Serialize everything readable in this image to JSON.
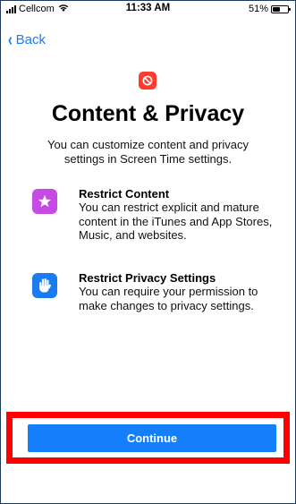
{
  "status_bar": {
    "carrier": "Cellcom",
    "time": "11:33 AM",
    "battery_percent": "51%",
    "battery_level": 0.51
  },
  "nav": {
    "back_label": "Back"
  },
  "header": {
    "icon": "screen-time-restrictions-icon",
    "icon_color": "#ff3b30",
    "title": "Content & Privacy",
    "subtitle": "You can customize content and privacy settings in Screen Time settings."
  },
  "features": [
    {
      "icon": "star-icon",
      "icon_color": "#c64be4",
      "title": "Restrict Content",
      "body": "You can restrict explicit and mature content in the iTunes and App Stores, Music, and websites."
    },
    {
      "icon": "hand-icon",
      "icon_color": "#1a7cf0",
      "title": "Restrict Privacy Settings",
      "body": "You can require your permission to make changes to privacy settings."
    }
  ],
  "footer": {
    "continue_label": "Continue",
    "accent": "#147efb",
    "highlight_color": "#ff0000"
  }
}
